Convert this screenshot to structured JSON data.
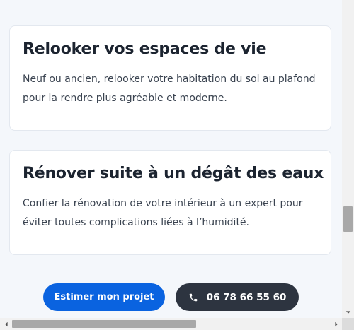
{
  "cards": [
    {
      "title": "Relooker vos espaces de vie",
      "description": "Neuf ou ancien, relooker votre habitation du sol au plafond pour la rendre plus agréable et moderne."
    },
    {
      "title": "Rénover suite à un dégât des eaux",
      "description": "Confier la rénovation de votre intérieur à un expert pour éviter toutes complications liées à l’humidité."
    }
  ],
  "actions": {
    "estimate_label": "Estimer mon projet",
    "phone_label": "06 78 66 55 60",
    "phone_icon": "phone-icon"
  },
  "colors": {
    "primary": "#0a63e0",
    "dark": "#2d3440",
    "background": "#f4f7fb",
    "card": "#ffffff",
    "text": "#1c2430"
  }
}
